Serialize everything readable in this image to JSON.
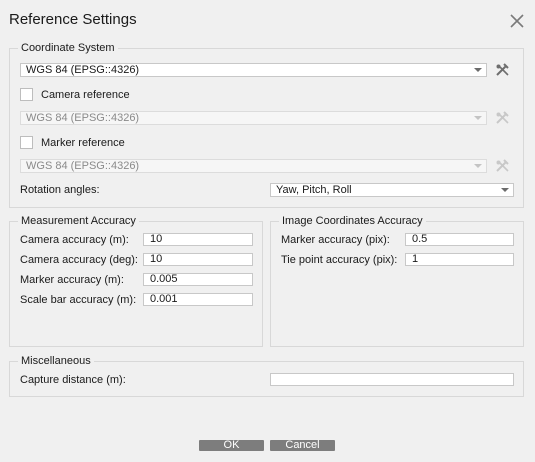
{
  "dialog": {
    "title": "Reference Settings"
  },
  "coordinate_system": {
    "group_title": "Coordinate System",
    "crs_value": "WGS 84 (EPSG::4326)",
    "camera_reference_label": "Camera reference",
    "camera_crs_value": "WGS 84 (EPSG::4326)",
    "marker_reference_label": "Marker reference",
    "marker_crs_value": "WGS 84 (EPSG::4326)",
    "rotation_label": "Rotation angles:",
    "rotation_value": "Yaw, Pitch, Roll"
  },
  "measurement_accuracy": {
    "group_title": "Measurement Accuracy",
    "rows": [
      {
        "label": "Camera accuracy (m):",
        "value": "10"
      },
      {
        "label": "Camera accuracy (deg):",
        "value": "10"
      },
      {
        "label": "Marker accuracy (m):",
        "value": "0.005"
      },
      {
        "label": "Scale bar accuracy (m):",
        "value": "0.001"
      }
    ]
  },
  "image_coordinates_accuracy": {
    "group_title": "Image Coordinates Accuracy",
    "rows": [
      {
        "label": "Marker accuracy (pix):",
        "value": "0.5"
      },
      {
        "label": "Tie point accuracy (pix):",
        "value": "1"
      }
    ]
  },
  "miscellaneous": {
    "group_title": "Miscellaneous",
    "capture_distance_label": "Capture distance (m):",
    "capture_distance_value": ""
  },
  "buttons": {
    "ok": "OK",
    "cancel": "Cancel"
  }
}
